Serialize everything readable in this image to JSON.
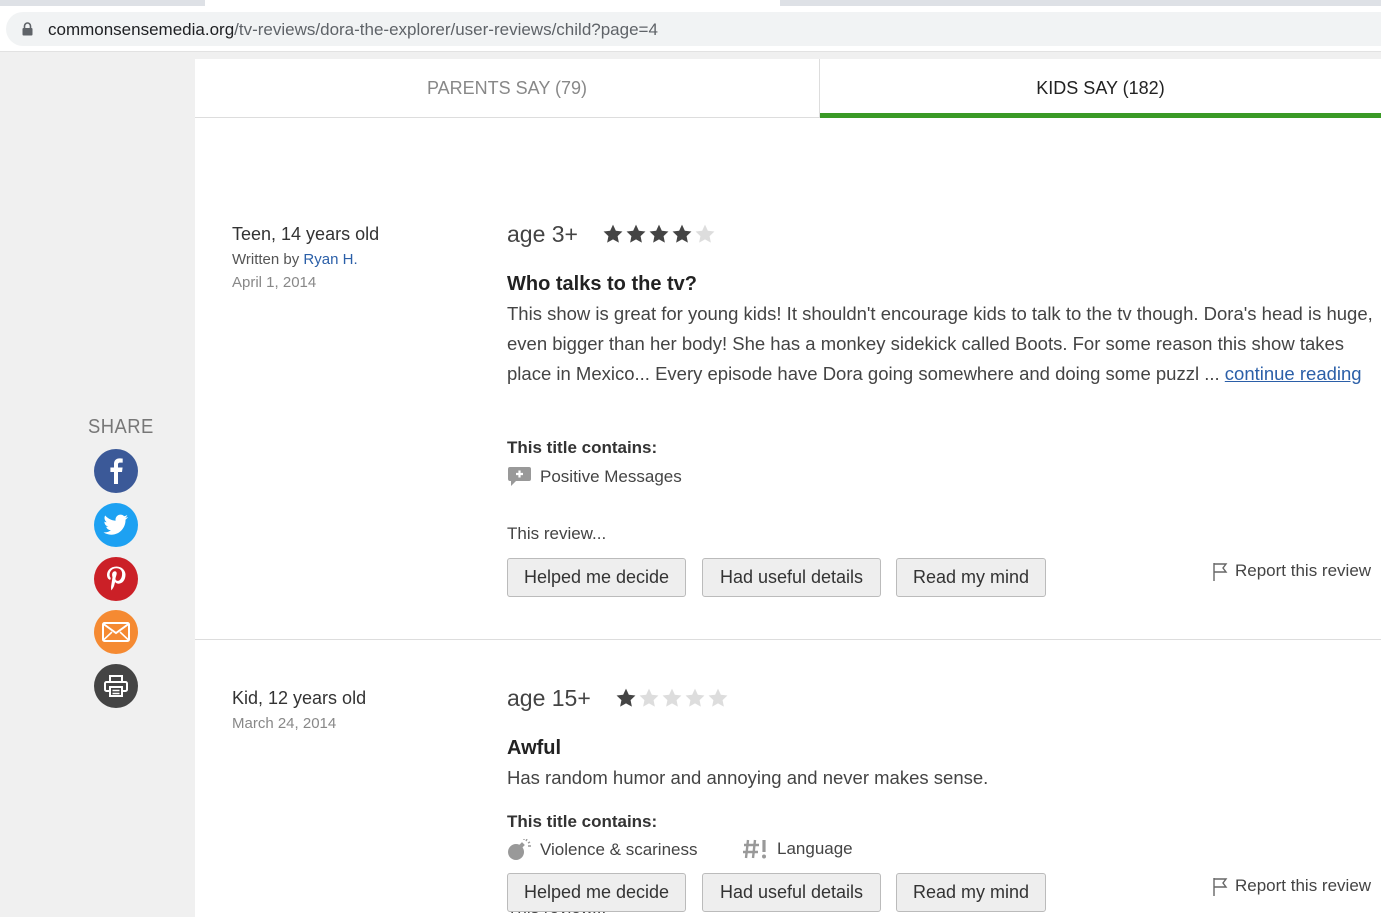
{
  "browser": {
    "url_host": "commonsensemedia.org",
    "url_path": "/tv-reviews/dora-the-explorer/user-reviews/child?page=4"
  },
  "share": {
    "label": "SHARE",
    "buttons": [
      {
        "name": "facebook-icon",
        "color": "#3b5998"
      },
      {
        "name": "twitter-icon",
        "color": "#1da1f2"
      },
      {
        "name": "pinterest-icon",
        "color": "#cb2027"
      },
      {
        "name": "email-icon",
        "color": "#f58a32"
      },
      {
        "name": "print-icon",
        "color": "#444444"
      }
    ]
  },
  "tabs": {
    "parents": "PARENTS SAY (79)",
    "kids": "KIDS SAY (182)",
    "active": "kids",
    "accent": "#3a9a26"
  },
  "reviews": [
    {
      "author": "Teen, 14 years old",
      "written_by_prefix": "Written by ",
      "written_by_name": "Ryan H.",
      "date": "April 1, 2014",
      "age": "age 3+",
      "rating": 4,
      "title": "Who talks to the tv?",
      "body": "This show is great for young kids! It shouldn't encourage kids to talk to the tv though. Dora's head is huge, even bigger than her body! She has a monkey sidekick called Boots. For some reason this show takes place in Mexico... Every episode have Dora going somewhere and doing some puzzl ... ",
      "continue": "continue reading",
      "contains_heading": "This title contains:",
      "topics": [
        {
          "label": "Positive Messages",
          "icon": "positive-messages-icon"
        }
      ],
      "this_review": "This review...",
      "votes": [
        "Helped me decide",
        "Had useful details",
        "Read my mind"
      ],
      "report": "Report this review"
    },
    {
      "author": "Kid, 12 years old",
      "date": "March 24, 2014",
      "age": "age 15+",
      "rating": 1,
      "title": "Awful",
      "body": "Has random humor and annoying and never makes sense.",
      "contains_heading": "This title contains:",
      "topics": [
        {
          "label": "Violence & scariness",
          "icon": "violence-bomb-icon"
        },
        {
          "label": "Language",
          "icon": "language-icon"
        }
      ],
      "this_review": "This review...",
      "votes": [
        "Helped me decide",
        "Had useful details",
        "Read my mind"
      ],
      "report": "Report this review"
    }
  ]
}
